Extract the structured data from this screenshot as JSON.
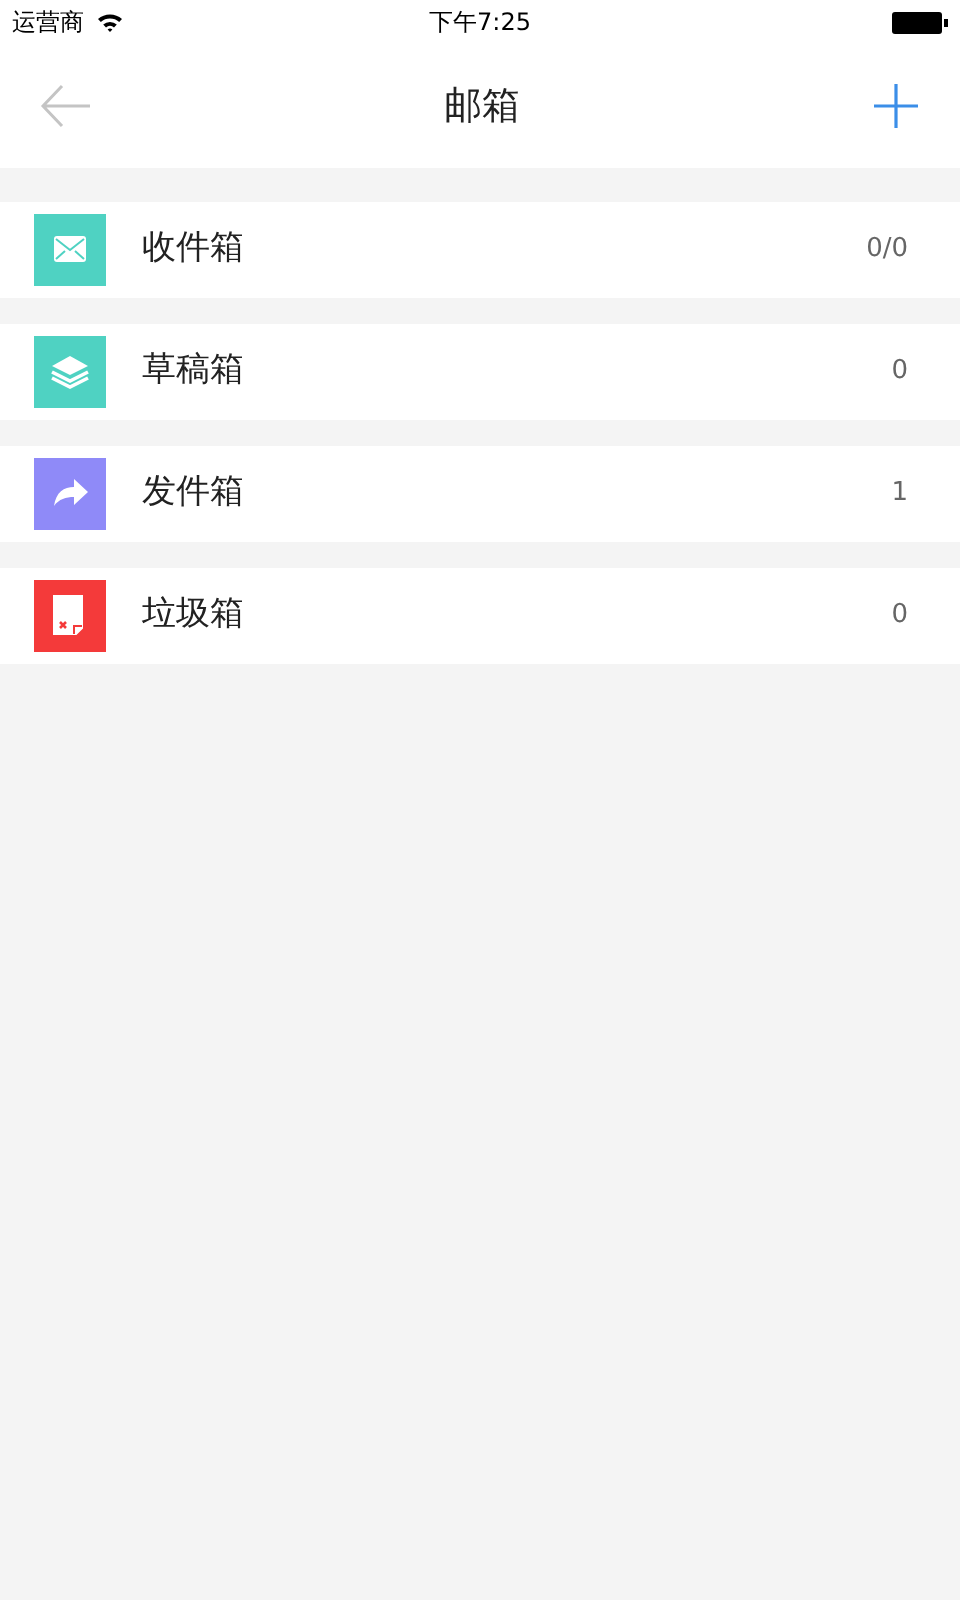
{
  "status_bar": {
    "carrier": "运营商",
    "time": "下午7:25"
  },
  "nav_bar": {
    "title": "邮箱"
  },
  "folders": [
    {
      "kind": "inbox",
      "label": "收件箱",
      "count": "0/0",
      "color": "#4fd2c2"
    },
    {
      "kind": "drafts",
      "label": "草稿箱",
      "count": "0",
      "color": "#4fd2c2"
    },
    {
      "kind": "sent",
      "label": "发件箱",
      "count": "1",
      "color": "#8f8af8"
    },
    {
      "kind": "trash",
      "label": "垃圾箱",
      "count": "0",
      "color": "#f43a3a"
    }
  ]
}
